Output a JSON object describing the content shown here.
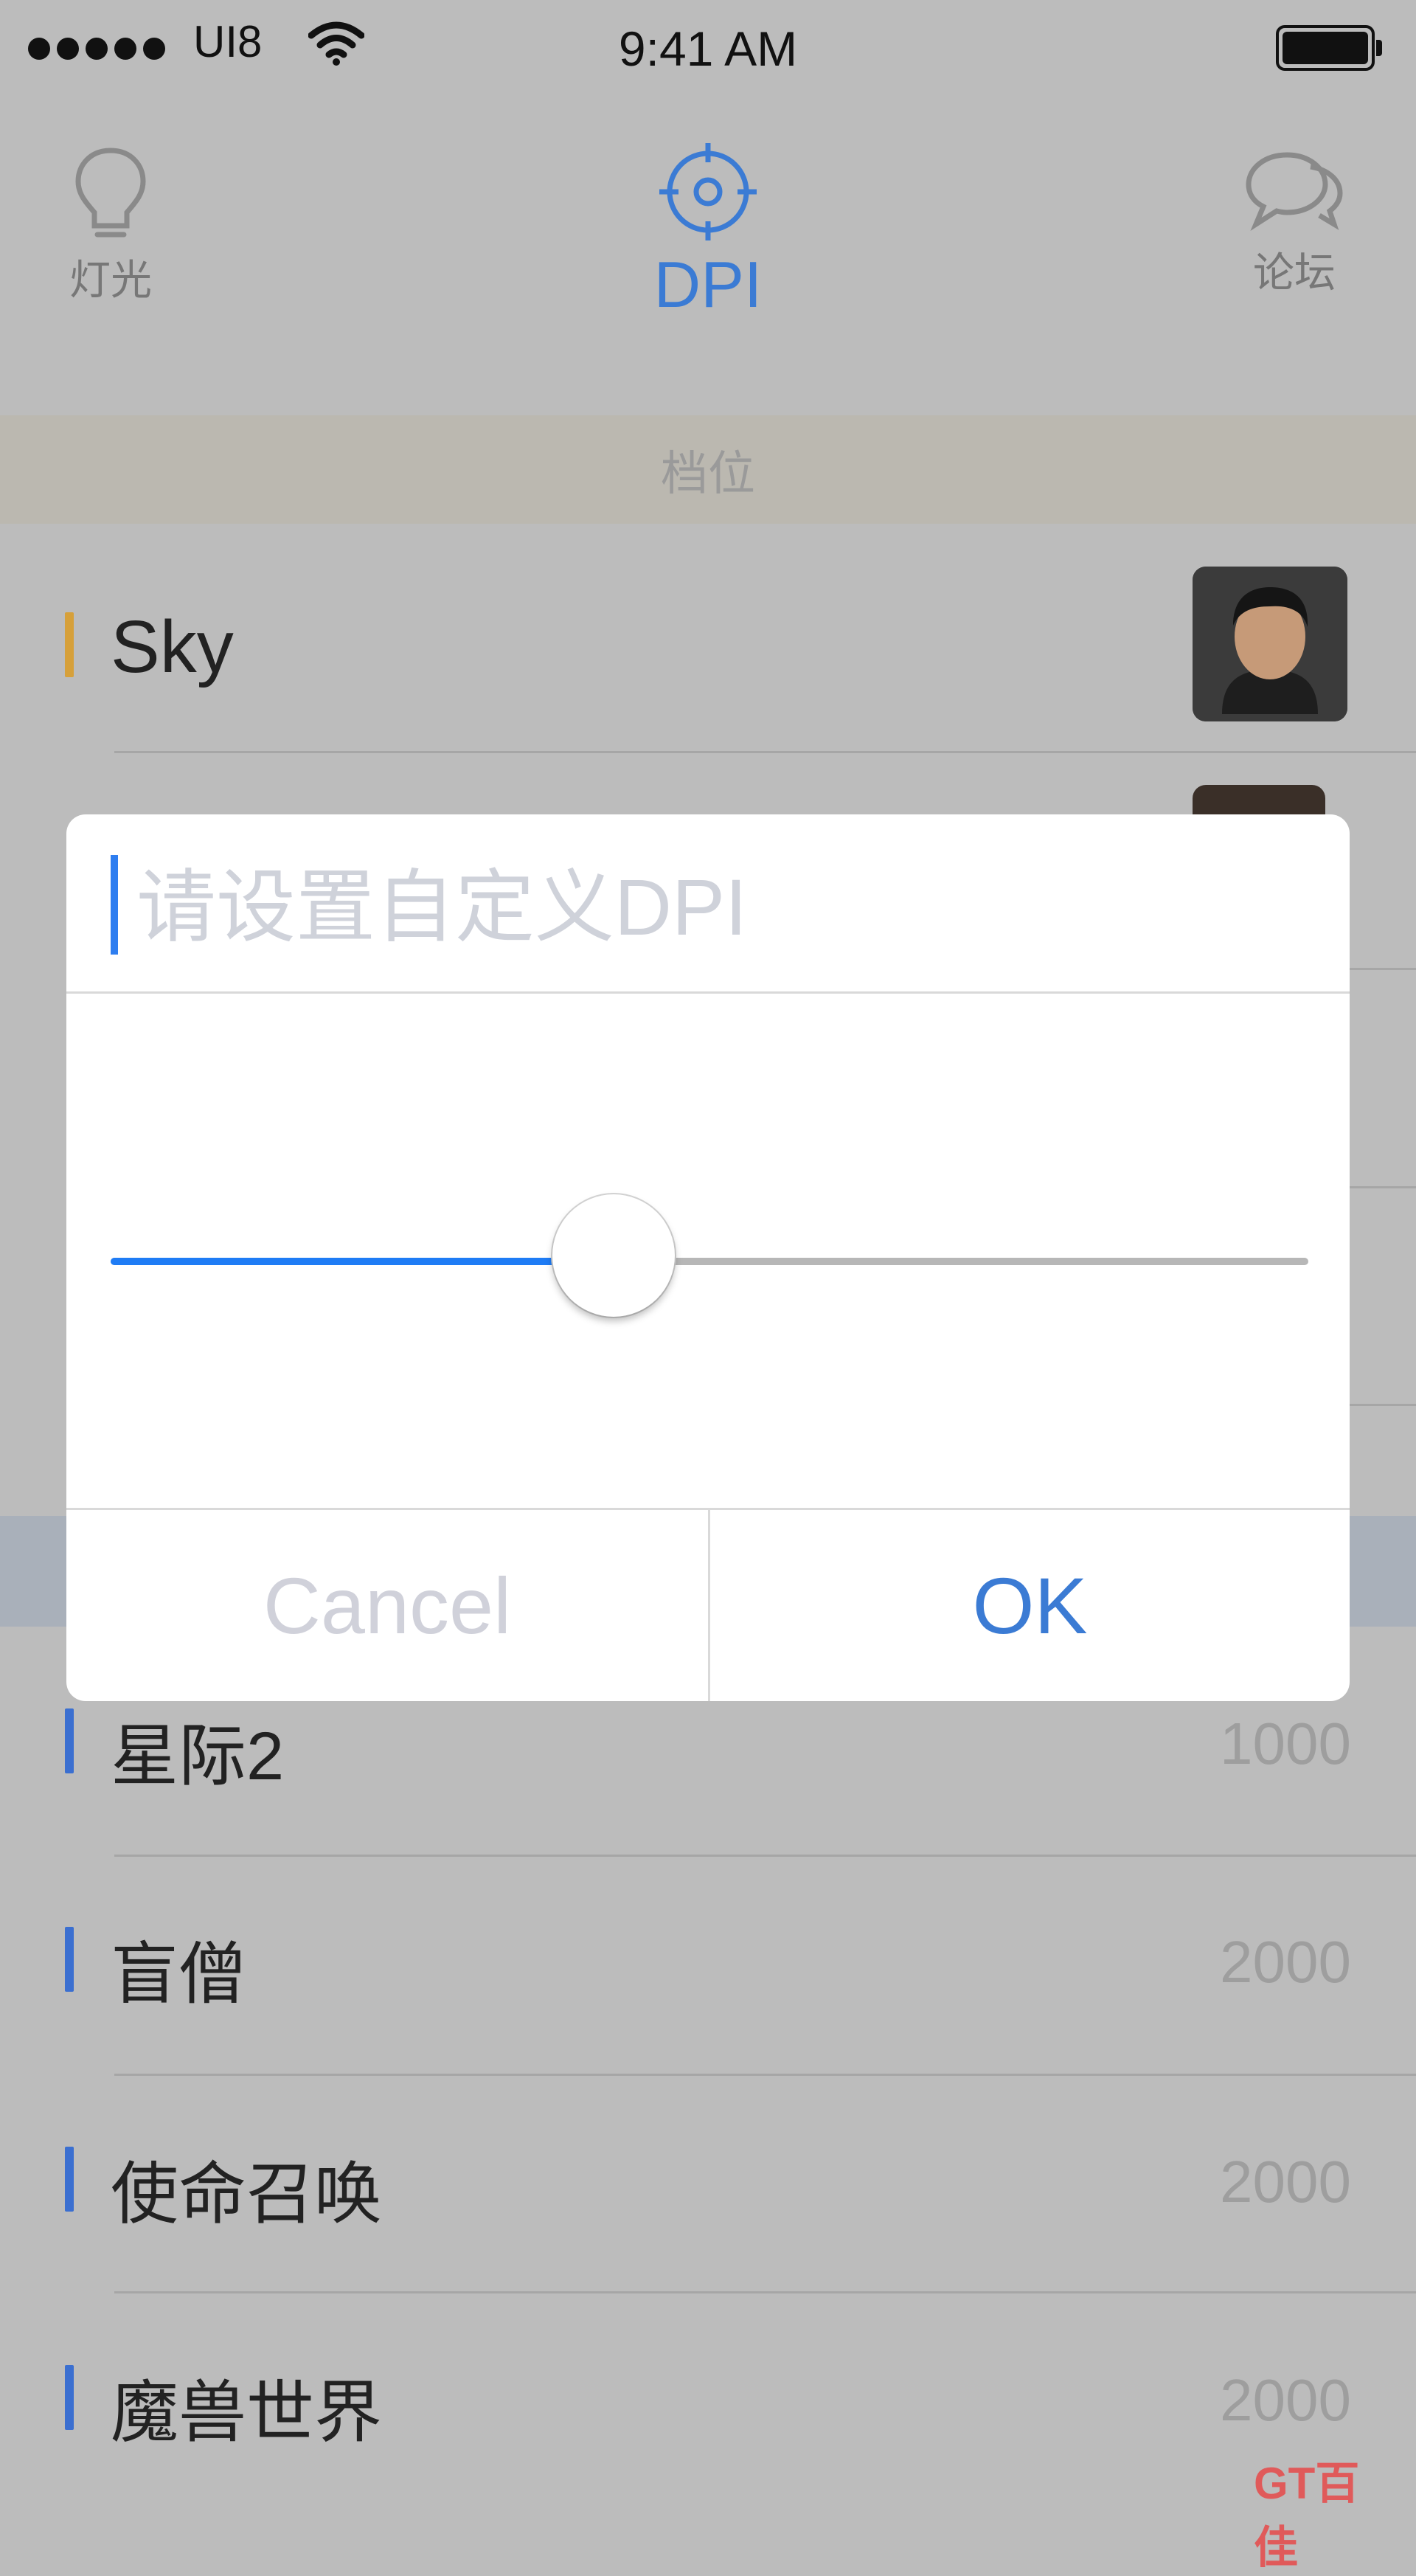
{
  "status_bar": {
    "carrier": "UI8",
    "time": "9:41 AM"
  },
  "tabs": [
    {
      "label": "灯光",
      "icon": "lightbulb-icon",
      "active": false
    },
    {
      "label": "DPI",
      "icon": "crosshair-icon",
      "active": true
    },
    {
      "label": "论坛",
      "icon": "chat-bubbles-icon",
      "active": false
    }
  ],
  "section_header": "档位",
  "profiles_top": [
    {
      "name": "Sky",
      "bar_color": "#d6a03a"
    }
  ],
  "games": [
    {
      "name": "星际2",
      "value": "1000"
    },
    {
      "name": "盲僧",
      "value": "2000"
    },
    {
      "name": "使命召唤",
      "value": "2000"
    },
    {
      "name": "魔兽世界",
      "value": "2000"
    }
  ],
  "dialog": {
    "input_placeholder": "请设置自定义DPI",
    "slider_fraction": 0.42,
    "cancel_label": "Cancel",
    "ok_label": "OK"
  },
  "colors": {
    "accent": "#3b7bd4",
    "slider_fill": "#1f7cf5",
    "list_bar": "#3b6fd0"
  },
  "watermark": "GT百佳"
}
